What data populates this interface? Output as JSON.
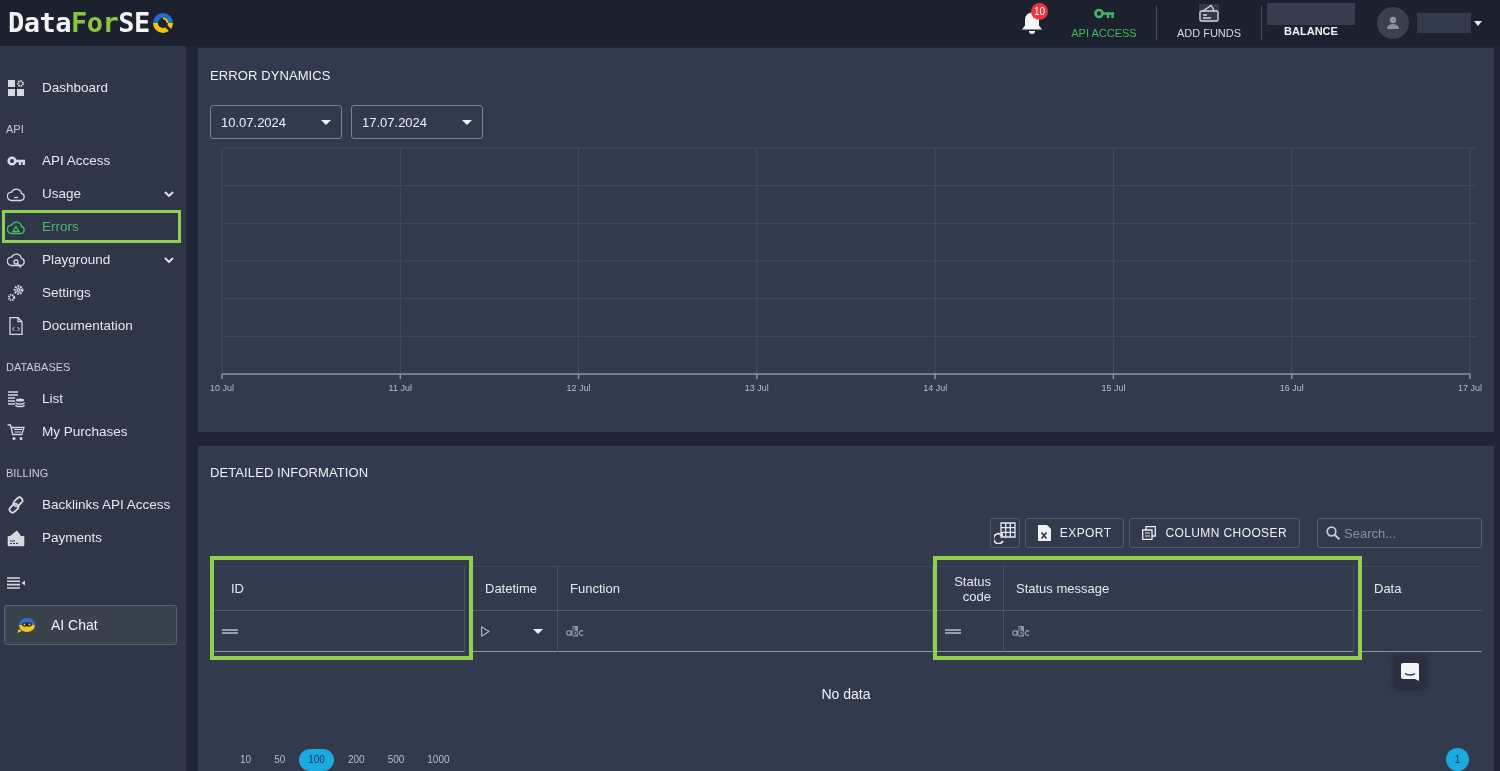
{
  "logo": {
    "lead": "Data",
    "accent": "For",
    "tail": "SE"
  },
  "header": {
    "notifications": {
      "count": "10"
    },
    "nav": [
      {
        "label": "API ACCESS",
        "selected": true
      },
      {
        "label": "ADD FUNDS",
        "selected": false
      }
    ],
    "balance": {
      "label": "BALANCE"
    }
  },
  "sidebar": {
    "sections": [
      {
        "items": [
          {
            "label": "Dashboard",
            "selected": false,
            "highlighted": false,
            "has_submenu": false
          }
        ]
      },
      {
        "title": "API",
        "items": [
          {
            "label": "API Access",
            "selected": false,
            "highlighted": false,
            "has_submenu": false
          },
          {
            "label": "Usage",
            "selected": false,
            "highlighted": false,
            "has_submenu": true
          },
          {
            "label": "Errors",
            "selected": true,
            "highlighted": true,
            "has_submenu": false
          },
          {
            "label": "Playground",
            "selected": false,
            "highlighted": false,
            "has_submenu": true
          },
          {
            "label": "Settings",
            "selected": false,
            "highlighted": false,
            "has_submenu": false
          },
          {
            "label": "Documentation",
            "selected": false,
            "highlighted": false,
            "has_submenu": false
          }
        ]
      },
      {
        "title": "DATABASES",
        "items": [
          {
            "label": "List",
            "selected": false,
            "highlighted": false,
            "has_submenu": false
          },
          {
            "label": "My Purchases",
            "selected": false,
            "highlighted": false,
            "has_submenu": false
          }
        ]
      },
      {
        "title": "BILLING",
        "items": [
          {
            "label": "Backlinks API Access",
            "selected": false,
            "highlighted": false,
            "has_submenu": false
          },
          {
            "label": "Payments",
            "selected": false,
            "highlighted": false,
            "has_submenu": false
          }
        ]
      }
    ],
    "ai_chat": {
      "label": "AI Chat"
    }
  },
  "error_dynamics": {
    "title": "ERROR DYNAMICS",
    "date_range": [
      {
        "value": "10.07.2024"
      },
      {
        "value": "17.07.2024"
      }
    ],
    "empty_chart": {
      "x_labels": [
        "10 Jul",
        "11 Jul",
        "12 Jul",
        "13 Jul",
        "14 Jul",
        "15 Jul",
        "16 Jul",
        "17 Jul"
      ]
    }
  },
  "detailed_information": {
    "title": "DETAILED INFORMATION",
    "toolbar": {
      "buttons": [
        {
          "label": "EXPORT"
        },
        {
          "label": "COLUMN CHOOSER"
        }
      ],
      "search": {
        "placeholder": "Search..."
      }
    },
    "table": {
      "columns": [
        {
          "label": "ID",
          "kind": "id",
          "highlighted": true
        },
        {
          "label": "Datetime",
          "kind": "date",
          "highlighted": false
        },
        {
          "label": "Function",
          "kind": "text",
          "highlighted": false
        },
        {
          "label": "Status code",
          "kind": "number",
          "highlighted": true
        },
        {
          "label": "Status message",
          "kind": "text",
          "highlighted": true
        },
        {
          "label": "Data",
          "kind": "object",
          "highlighted": false
        }
      ],
      "empty_text": "No data"
    },
    "page_sizes": [
      {
        "label": "10",
        "selected": false
      },
      {
        "label": "50",
        "selected": false
      },
      {
        "label": "100",
        "selected": true
      },
      {
        "label": "200",
        "selected": false
      },
      {
        "label": "500",
        "selected": false
      },
      {
        "label": "1000",
        "selected": false
      }
    ],
    "pages": [
      {
        "label": "1",
        "selected": true
      }
    ]
  }
}
